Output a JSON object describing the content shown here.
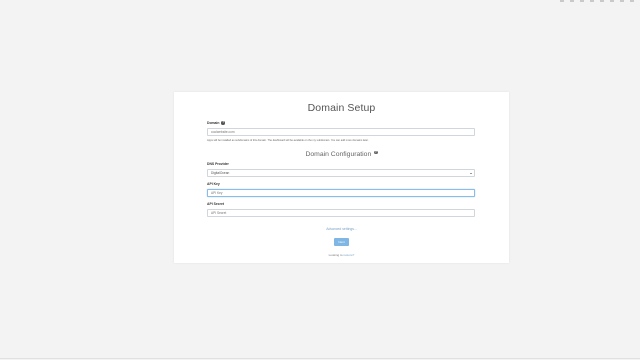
{
  "page": {
    "title": "Domain Setup",
    "domain_label": "Domain",
    "domain_placeholder": "coolwebsite.com",
    "domain_help": "Apps will be installed as subdomains of this domain. The dashboard will be available on the my subdomain. You can add more domains later.",
    "section_title": "Domain Configuration",
    "dns_label": "DNS Provider",
    "dns_selected": "DigitalOcean",
    "api_key_label": "API Key",
    "api_key_placeholder": "API Key",
    "api_secret_label": "API Secret",
    "api_secret_placeholder": "API Secret",
    "advanced_link": "Advanced settings...",
    "next_button": "Next",
    "login_prefix": "Looking to",
    "login_link": "restore?",
    "help_glyph": "?"
  },
  "icons": {
    "help": "question-circle-icon",
    "caret": "chevron-down-icon"
  },
  "colors": {
    "accent": "#7fb6e3",
    "link": "#7aa3c8",
    "background": "#f3f3f4"
  }
}
